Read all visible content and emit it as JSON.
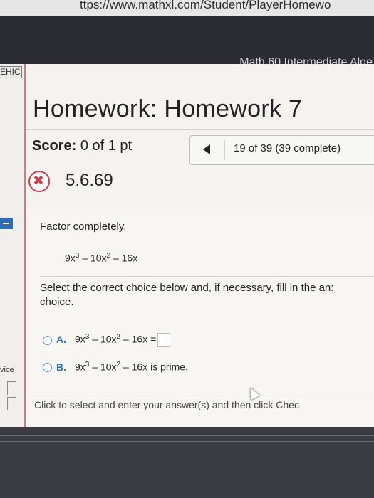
{
  "browser": {
    "url": "ttps://www.mathxl.com/Student/PlayerHomewo"
  },
  "course": {
    "title": "Math 60 Intermediate Alge"
  },
  "sidebar": {
    "tab_label": "EHIC",
    "vice_label": "vice"
  },
  "homework": {
    "title": "Homework: Homework 7"
  },
  "score": {
    "label": "Score:",
    "value": "0 of 1 pt"
  },
  "navigation": {
    "progress": "19 of 39 (39 complete)"
  },
  "problem": {
    "status": "incorrect",
    "number": "5.6.69",
    "instruction": "Factor completely.",
    "expression": {
      "a": "9x",
      "exp1": "3",
      "b": " – 10x",
      "exp2": "2",
      "c": " – 16x"
    },
    "select_line1": "Select the correct choice below and, if necessary, fill in the an:",
    "select_line2": "choice.",
    "options": [
      {
        "letter": "A.",
        "a": "9x",
        "exp1": "3",
        "b": " – 10x",
        "exp2": "2",
        "c": " – 16x =",
        "selected": false
      },
      {
        "letter": "B.",
        "a": "9x",
        "exp1": "3",
        "b": " – 10x",
        "exp2": "2",
        "c": " – 16x is prime.",
        "selected": false
      }
    ]
  },
  "footer": {
    "hint": "Click to select and enter your answer(s) and then click Chec"
  },
  "colors": {
    "accent": "#2f6db5",
    "error": "#d43c4c",
    "panel": "#f4f3f0",
    "chrome": "#2b2c31"
  }
}
